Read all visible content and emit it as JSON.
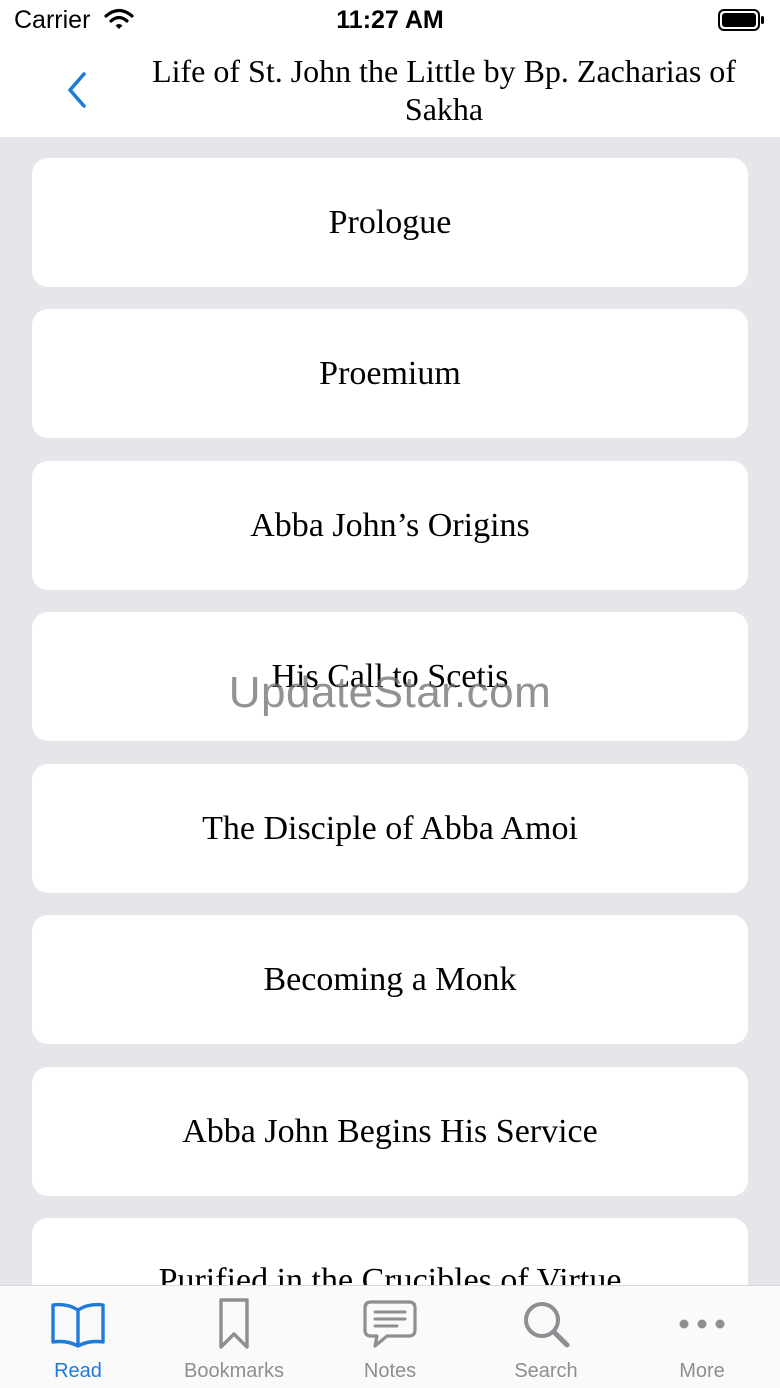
{
  "status_bar": {
    "carrier": "Carrier",
    "time": "11:27 AM"
  },
  "nav": {
    "title": "Life of St. John the Little by Bp. Zacharias of Sakha",
    "back_icon": "chevron-left-icon"
  },
  "chapters": [
    "Prologue",
    "Proemium",
    "Abba John’s Origins",
    "His Call to Scetis",
    "The Disciple of Abba Amoi",
    "Becoming a Monk",
    "Abba John Begins His Service",
    "Purified in the Crucibles of Virtue"
  ],
  "watermark": "UpdateStar.com",
  "tabs": [
    {
      "label": "Read",
      "icon": "book-icon",
      "active": true
    },
    {
      "label": "Bookmarks",
      "icon": "bookmark-icon",
      "active": false
    },
    {
      "label": "Notes",
      "icon": "notes-icon",
      "active": false
    },
    {
      "label": "Search",
      "icon": "search-icon",
      "active": false
    },
    {
      "label": "More",
      "icon": "more-icon",
      "active": false
    }
  ],
  "colors": {
    "accent": "#1e7bd8",
    "inactive": "#8e8e93",
    "background": "#e5e5ea"
  }
}
